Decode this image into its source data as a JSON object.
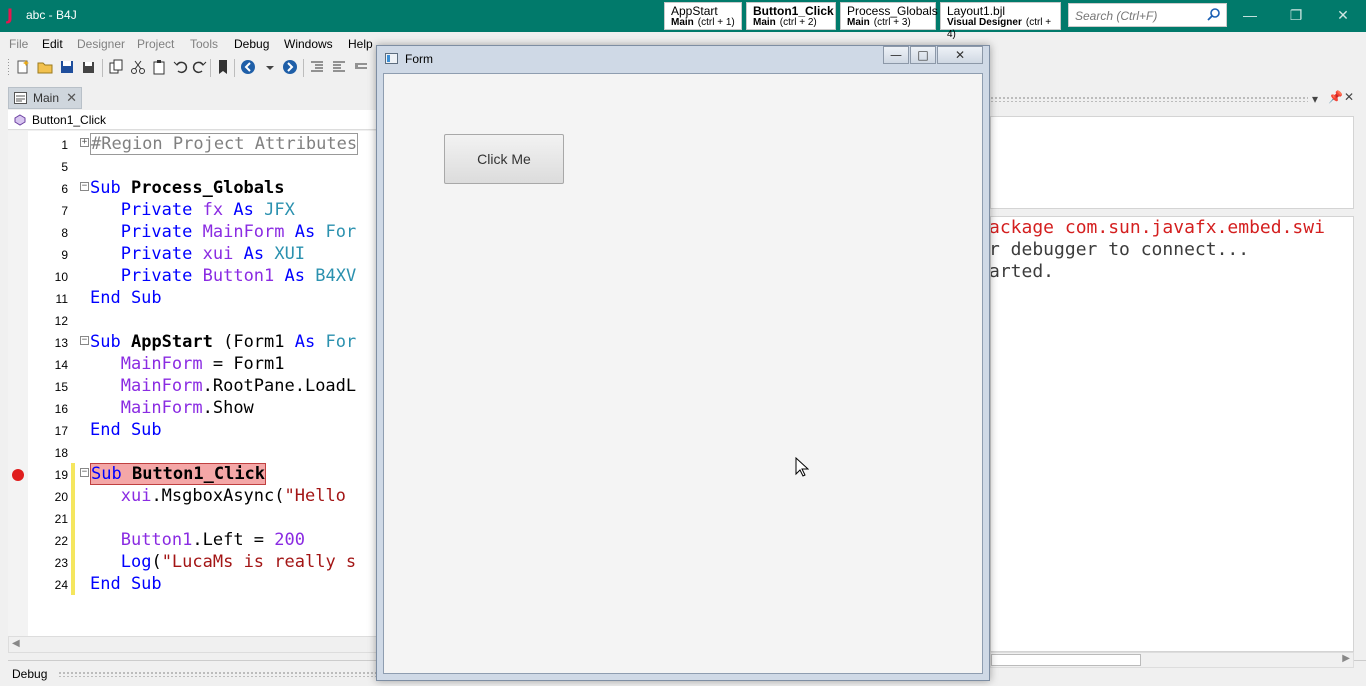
{
  "window": {
    "title": "abc - B4J"
  },
  "quick_tabs": [
    {
      "title": "AppStart",
      "module": "Main",
      "shortcut": "(ctrl + 1)"
    },
    {
      "title": "Button1_Click",
      "module": "Main",
      "shortcut": "(ctrl + 2)"
    },
    {
      "title": "Process_Globals",
      "module": "Main",
      "shortcut": "(ctrl + 3)"
    },
    {
      "title": "Layout1.bjl",
      "module": "Visual Designer",
      "shortcut": "(ctrl + 4)"
    }
  ],
  "search": {
    "placeholder": "Search (Ctrl+F)"
  },
  "menu": [
    "File",
    "Edit",
    "Designer",
    "Project",
    "Tools",
    "Debug",
    "Windows",
    "Help"
  ],
  "doc_tab": {
    "label": "Main"
  },
  "sub_selector": {
    "label": "Button1_Click"
  },
  "code_lines": [
    {
      "n": "1"
    },
    {
      "n": "5"
    },
    {
      "n": "6"
    },
    {
      "n": "7"
    },
    {
      "n": "8"
    },
    {
      "n": "9"
    },
    {
      "n": "10"
    },
    {
      "n": "11"
    },
    {
      "n": "12"
    },
    {
      "n": "13"
    },
    {
      "n": "14"
    },
    {
      "n": "15"
    },
    {
      "n": "16"
    },
    {
      "n": "17"
    },
    {
      "n": "18"
    },
    {
      "n": "19"
    },
    {
      "n": "20"
    },
    {
      "n": "21"
    },
    {
      "n": "22"
    },
    {
      "n": "23"
    },
    {
      "n": "24"
    }
  ],
  "code": {
    "l1": "#Region Project Attributes",
    "l6_kw": "Sub",
    "l6_name": "Process_Globals",
    "l7_kw": "Private",
    "l7_var": "fx",
    "l7_as": "As",
    "l7_type": "JFX",
    "l8_kw": "Private",
    "l8_var": "MainForm",
    "l8_as": "As",
    "l8_type": "For",
    "l9_kw": "Private",
    "l9_var": "xui",
    "l9_as": "As",
    "l9_type": "XUI",
    "l10_kw": "Private",
    "l10_var": "Button1",
    "l10_as": "As",
    "l10_type": "B4XV",
    "l11": "End Sub",
    "l13_kw": "Sub",
    "l13_name": "AppStart",
    "l13_rest": " (Form1 ",
    "l13_as": "As",
    "l13_type": "For",
    "l14_var": "MainForm",
    "l14_rest": " = Form1",
    "l15_var": "MainForm",
    "l15_rest": ".RootPane.LoadL",
    "l16_var": "MainForm",
    "l16_rest": ".Show",
    "l17": "End Sub",
    "l19_kw": "Sub",
    "l19_name": "Button1_Click",
    "l20_var": "xui",
    "l20_rest": ".MsgboxAsync(",
    "l20_str": "\"Hello",
    "l22_var": "Button1",
    "l22_rest": ".Left = ",
    "l22_num": "200",
    "l23_fn": "Log",
    "l23_rest": "(",
    "l23_str": "\"LucaMs is really s",
    "l24": "End Sub"
  },
  "bottom_panel": {
    "label": "Debug"
  },
  "log": {
    "line1": "ackage com.sun.javafx.embed.swi",
    "line2": "r debugger to connect...",
    "line3": "arted."
  },
  "form_window": {
    "title": "Form",
    "button_label": "Click Me"
  },
  "colors": {
    "titlebar": "#017a6b",
    "keyword": "#0000ff",
    "type": "#2b91af",
    "variable": "#8a2be2",
    "string": "#a31515",
    "breakpoint": "#e01e1e",
    "log_error": "#d41f1f"
  }
}
